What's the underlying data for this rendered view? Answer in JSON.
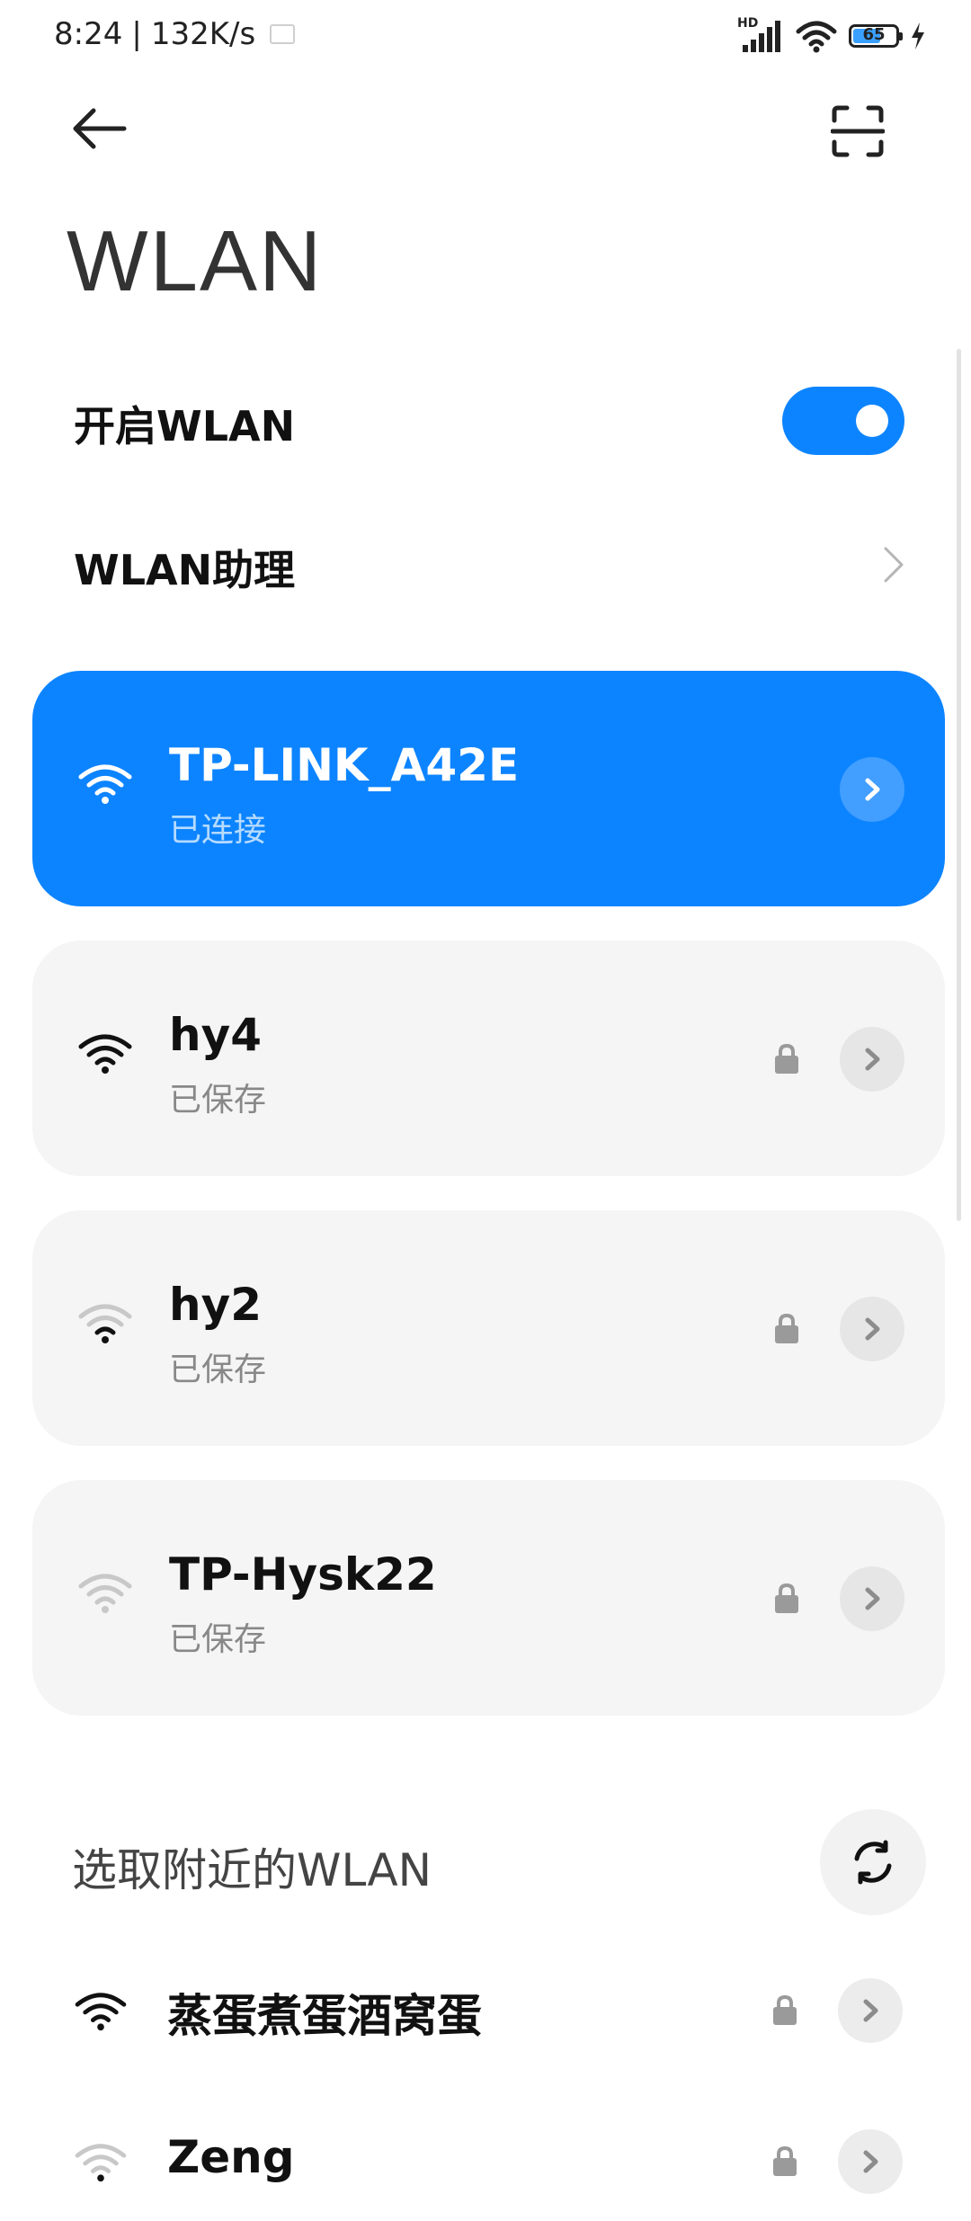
{
  "status_bar": {
    "time": "8:24",
    "network_speed": "132K/s",
    "hd_label": "HD",
    "battery_level": "65",
    "battery_fraction": 0.65,
    "icons": [
      "mail-icon",
      "signal-icon",
      "wifi-icon",
      "battery-icon",
      "charging-icon"
    ]
  },
  "header": {
    "title": "WLAN",
    "back_icon": "back-arrow-icon",
    "scan_icon": "scan-icon"
  },
  "settings": {
    "enable_wlan_label": "开启WLAN",
    "enable_wlan_on": true,
    "assistant_label": "WLAN助理"
  },
  "saved_networks": [
    {
      "name": "TP-LINK_A42E",
      "status": "已连接",
      "connected": true,
      "secured": false,
      "signal": 4
    },
    {
      "name": "hy4",
      "status": "已保存",
      "connected": false,
      "secured": true,
      "signal": 4
    },
    {
      "name": "hy2",
      "status": "已保存",
      "connected": false,
      "secured": true,
      "signal": 2
    },
    {
      "name": "TP-Hysk22",
      "status": "已保存",
      "connected": false,
      "secured": true,
      "signal": 1
    }
  ],
  "nearby": {
    "title": "选取附近的WLAN",
    "refresh_icon": "refresh-icon",
    "networks": [
      {
        "name": "蒸蛋煮蛋酒窝蛋",
        "secured": true,
        "signal": 4
      },
      {
        "name": "Zeng",
        "secured": true,
        "signal": 1
      }
    ]
  },
  "colors": {
    "accent": "#0d84ff",
    "card_bg": "#f5f5f5",
    "text_primary": "#111111",
    "text_secondary": "#888888"
  }
}
